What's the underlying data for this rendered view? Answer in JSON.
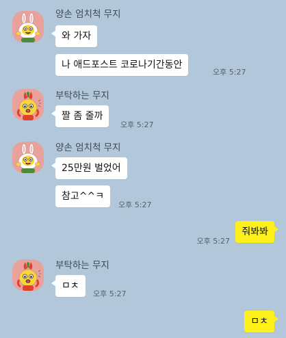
{
  "colors": {
    "background": "#b2c7d9",
    "bubble_other": "#ffffff",
    "bubble_mine": "#fef01b",
    "avatar_bg": "#e8a29b"
  },
  "messages": [
    {
      "sender": "양손 엄치척 무지",
      "avatar": "muzi-thumbs-up-icon",
      "bubbles": [
        "와 가자",
        "나 애드포스트 코로나기간동안"
      ],
      "time": "오후 5:27"
    },
    {
      "sender": "부탁하는 무지",
      "avatar": "muzi-begging-icon",
      "bubbles": [
        "짤 좀 줄까"
      ],
      "time": "오후 5:27"
    },
    {
      "sender": "양손 엄치척 무지",
      "avatar": "muzi-thumbs-up-icon",
      "bubbles": [
        "25만원 벌었어",
        "참고^^ㅋ"
      ],
      "time": "오후 5:27"
    },
    {
      "mine": true,
      "bubbles": [
        "줘봐봐"
      ],
      "time": "오후 5:27"
    },
    {
      "sender": "부탁하는 무지",
      "avatar": "muzi-begging-icon",
      "bubbles": [
        "ㅁㅊ"
      ],
      "time": "오후 5:27"
    },
    {
      "mine": true,
      "bubbles": [
        "ㅁㅊ"
      ],
      "time": ""
    }
  ]
}
